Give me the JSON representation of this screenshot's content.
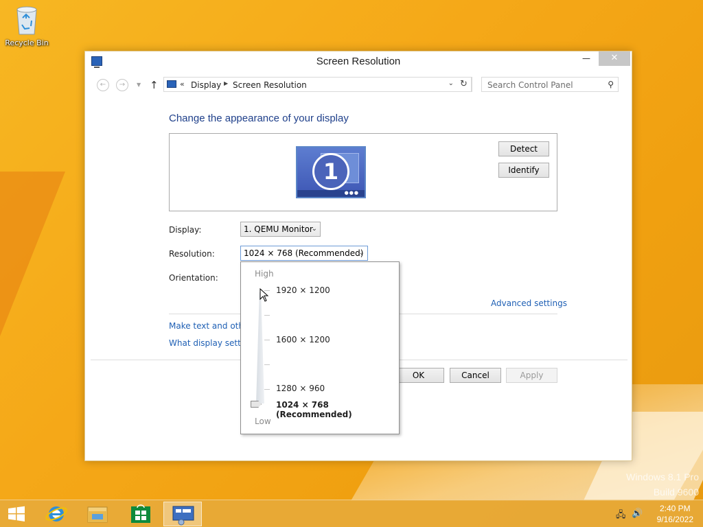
{
  "desktop": {
    "recycle_bin_label": "Recycle Bin",
    "watermark_line1": "Windows 8.1 Pro",
    "watermark_line2": "Build 9600"
  },
  "window": {
    "title": "Screen Resolution",
    "controls": {
      "minimize": "—",
      "maximize": "☐",
      "close": "✕"
    }
  },
  "address_bar": {
    "overflow": "«",
    "crumbs": [
      "Display",
      "Screen Resolution"
    ],
    "search_placeholder": "Search Control Panel"
  },
  "main": {
    "heading": "Change the appearance of your display",
    "monitor_number": "1",
    "detect_label": "Detect",
    "identify_label": "Identify",
    "display_label": "Display:",
    "display_value": "1. QEMU Monitor",
    "resolution_label": "Resolution:",
    "resolution_value": "1024 × 768 (Recommended)",
    "orientation_label": "Orientation:",
    "advanced_link": "Advanced settings",
    "link_text_size": "Make text and other",
    "link_display_settings": "What display setting",
    "ok_label": "OK",
    "cancel_label": "Cancel",
    "apply_label": "Apply"
  },
  "resolution_dropdown": {
    "high_label": "High",
    "low_label": "Low",
    "options": [
      "1920 × 1200",
      "1600 × 1200",
      "1280 × 960",
      "1024 × 768 (Recommended)"
    ],
    "selected_index": 3
  },
  "taskbar": {
    "time": "2:40 PM",
    "date": "9/16/2022",
    "pinned": [
      "start-button",
      "internet-explorer",
      "file-explorer",
      "store",
      "screen-resolution"
    ]
  },
  "colors": {
    "link": "#1e5fb4",
    "heading": "#1e3f8a",
    "desktop": "#f5a818"
  }
}
